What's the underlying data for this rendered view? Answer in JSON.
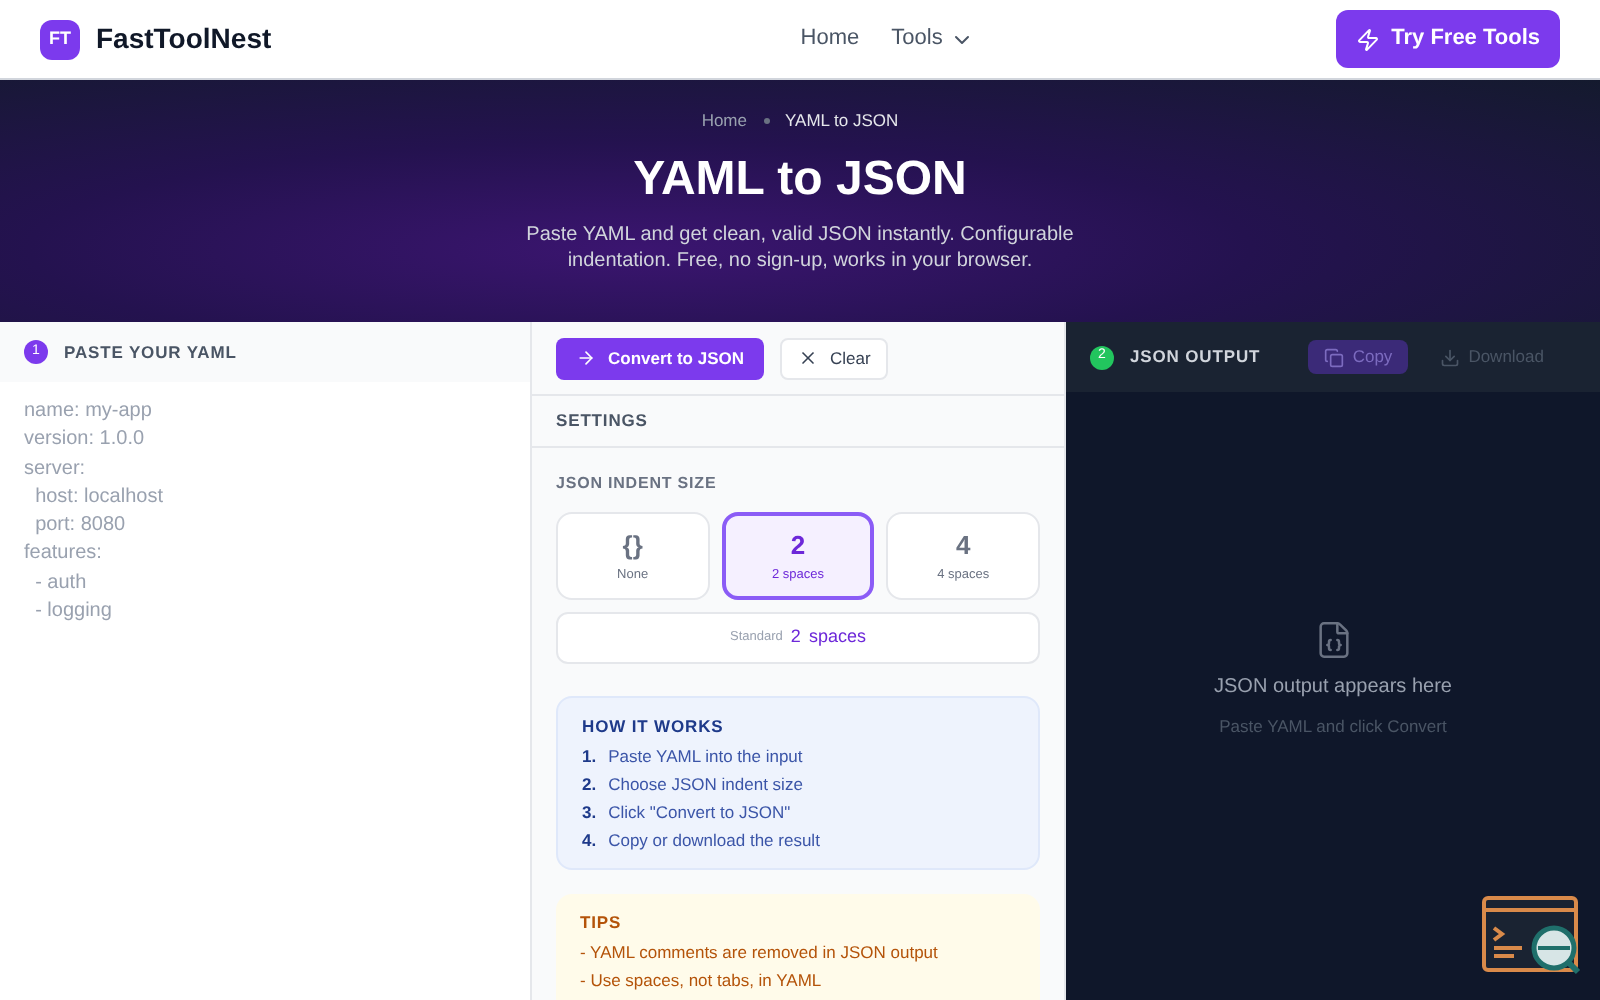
{
  "header": {
    "logo_mark": "FT",
    "brand": "FastToolNest",
    "nav": [
      {
        "label": "Home",
        "kind": "link"
      },
      {
        "label": "Tools",
        "kind": "dropdown"
      }
    ],
    "cta": "Try Free Tools"
  },
  "hero": {
    "breadcrumb": [
      {
        "label": "Home",
        "selected": false
      },
      {
        "label": "YAML to JSON",
        "selected": true
      }
    ],
    "title": "YAML to JSON",
    "subtitle": "Paste YAML and get clean, valid JSON instantly. Configurable indentation. Free, no sign-up, works in your browser."
  },
  "input_panel": {
    "step": "1",
    "title": "PASTE YOUR YAML",
    "placeholder": "name: my-app\nversion: 1.0.0\nserver:\n  host: localhost\n  port: 8080\nfeatures:\n  - auth\n  - logging"
  },
  "actions": {
    "convert": "Convert to JSON",
    "clear": "Clear"
  },
  "settings": {
    "title": "SETTINGS",
    "indent_label": "JSON INDENT SIZE",
    "options": [
      {
        "symbol": "{}",
        "label": "None",
        "selected": false
      },
      {
        "symbol": "2",
        "label": "2 spaces",
        "selected": true
      },
      {
        "symbol": "4",
        "label": "4 spaces",
        "selected": false
      }
    ],
    "preview": {
      "label": "Standard",
      "value": "2",
      "unit": "spaces"
    }
  },
  "how_it_works": {
    "title": "HOW IT WORKS",
    "steps": [
      {
        "number": "1.",
        "text": "Paste YAML into the input"
      },
      {
        "number": "2.",
        "text": "Choose JSON indent size"
      },
      {
        "number": "3.",
        "text": "Click \"Convert to JSON\""
      },
      {
        "number": "4.",
        "text": "Copy or download the result"
      }
    ]
  },
  "tips": {
    "title": "TIPS",
    "items": [
      "- YAML comments are removed in JSON output",
      "- Use spaces, not tabs, in YAML"
    ]
  },
  "output_panel": {
    "step": "2",
    "title": "JSON OUTPUT",
    "copy": "Copy",
    "download": "Download",
    "empty_title": "JSON output appears here",
    "empty_hint": "Paste YAML and click Convert"
  }
}
